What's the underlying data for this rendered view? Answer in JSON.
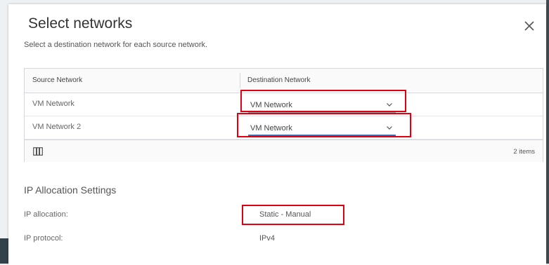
{
  "dialog": {
    "title": "Select networks",
    "subtitle": "Select a destination network for each source network.",
    "close_icon": "close-icon"
  },
  "grid": {
    "columns": [
      "Source Network",
      "Destination Network"
    ],
    "rows": [
      {
        "source": "VM Network",
        "destination": "VM Network"
      },
      {
        "source": "VM Network 2",
        "destination": "VM Network"
      }
    ],
    "footer": {
      "column_toggle_icon": "column-toggle-icon",
      "count": "2 items"
    }
  },
  "ip_settings": {
    "title": "IP Allocation Settings",
    "allocation_label": "IP allocation:",
    "allocation_value": "Static - Manual",
    "protocol_label": "IP protocol:",
    "protocol_value": "IPv4"
  },
  "colors": {
    "accent": "#2f6fb8",
    "highlight": "#e0000f"
  }
}
